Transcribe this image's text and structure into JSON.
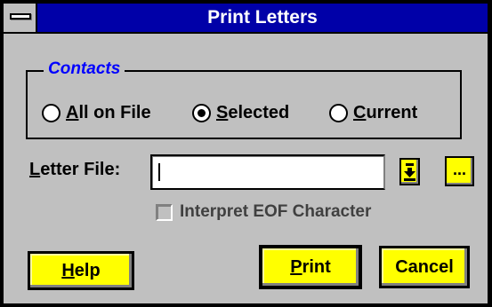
{
  "window": {
    "title": "Print Letters",
    "colors": {
      "title_bar": "#0000a8",
      "face": "#c0c0c0",
      "button_face": "#ffff00",
      "legend_text": "#0000ff"
    }
  },
  "contacts": {
    "legend": "Contacts",
    "options": [
      {
        "mnemonic": "A",
        "rest": "ll on File",
        "checked": false
      },
      {
        "mnemonic": "S",
        "rest": "elected",
        "checked": true
      },
      {
        "mnemonic": "C",
        "rest": "urrent",
        "checked": false
      }
    ]
  },
  "letter_file": {
    "label_mnemonic": "L",
    "label_rest": "etter File:",
    "value": "",
    "dropdown_icon": "down-arrow-icon",
    "browse_label": "..."
  },
  "interpret_eof": {
    "label": "Interpret EOF Character",
    "checked": false
  },
  "buttons": {
    "help": {
      "mnemonic": "H",
      "rest": "elp"
    },
    "print": {
      "mnemonic": "P",
      "rest": "rint"
    },
    "cancel": {
      "label": "Cancel"
    }
  }
}
